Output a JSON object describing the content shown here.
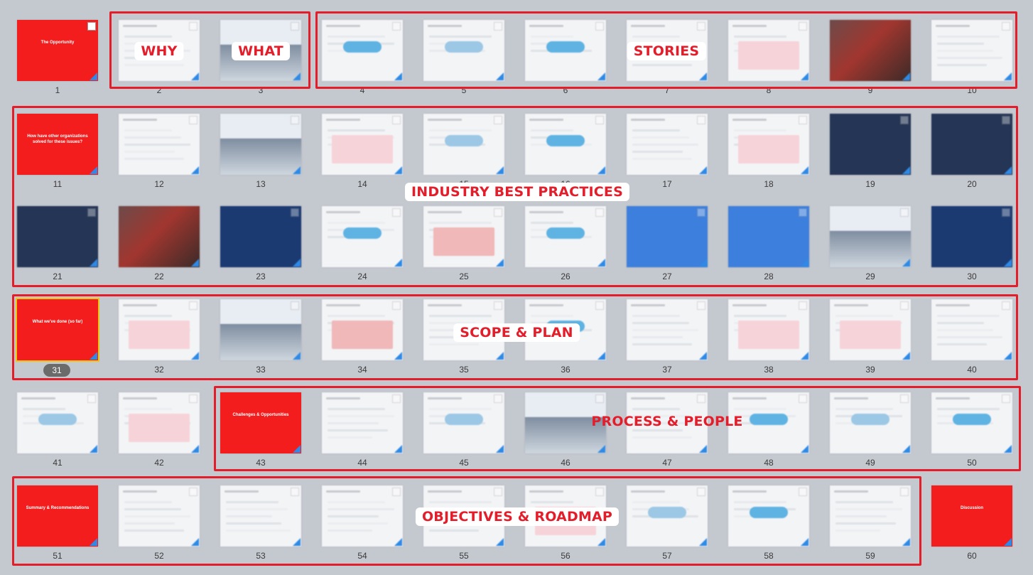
{
  "colors": {
    "accent_red": "#e41d2b",
    "slide_red": "#f31d1d",
    "selection": "#f1c40f"
  },
  "slides": [
    {
      "n": "1",
      "style": "red",
      "title": "The Opportunity"
    },
    {
      "n": "2",
      "style": "text"
    },
    {
      "n": "3",
      "style": "mixed"
    },
    {
      "n": "4",
      "style": "diagram"
    },
    {
      "n": "5",
      "style": "diagram"
    },
    {
      "n": "6",
      "style": "diagram"
    },
    {
      "n": "7",
      "style": "text"
    },
    {
      "n": "8",
      "style": "table"
    },
    {
      "n": "9",
      "style": "photo"
    },
    {
      "n": "10",
      "style": "text"
    },
    {
      "n": "11",
      "style": "red",
      "title": "How have other organizations solved for these issues?"
    },
    {
      "n": "12",
      "style": "text"
    },
    {
      "n": "13",
      "style": "mixed"
    },
    {
      "n": "14",
      "style": "table"
    },
    {
      "n": "15",
      "style": "diagram"
    },
    {
      "n": "16",
      "style": "diagram"
    },
    {
      "n": "17",
      "style": "text"
    },
    {
      "n": "18",
      "style": "table"
    },
    {
      "n": "19",
      "style": "dark"
    },
    {
      "n": "20",
      "style": "dark"
    },
    {
      "n": "21",
      "style": "dark"
    },
    {
      "n": "22",
      "style": "photo"
    },
    {
      "n": "23",
      "style": "navy"
    },
    {
      "n": "24",
      "style": "diagram"
    },
    {
      "n": "25",
      "style": "table"
    },
    {
      "n": "26",
      "style": "diagram"
    },
    {
      "n": "27",
      "style": "blue"
    },
    {
      "n": "28",
      "style": "blue"
    },
    {
      "n": "29",
      "style": "mixed"
    },
    {
      "n": "30",
      "style": "navy"
    },
    {
      "n": "31",
      "style": "red",
      "title": "What we've done (so far)",
      "selected": true
    },
    {
      "n": "32",
      "style": "table"
    },
    {
      "n": "33",
      "style": "mixed"
    },
    {
      "n": "34",
      "style": "table"
    },
    {
      "n": "35",
      "style": "text"
    },
    {
      "n": "36",
      "style": "diagram"
    },
    {
      "n": "37",
      "style": "text"
    },
    {
      "n": "38",
      "style": "table"
    },
    {
      "n": "39",
      "style": "table"
    },
    {
      "n": "40",
      "style": "text"
    },
    {
      "n": "41",
      "style": "diagram"
    },
    {
      "n": "42",
      "style": "table"
    },
    {
      "n": "43",
      "style": "red",
      "title": "Challenges & Opportunities"
    },
    {
      "n": "44",
      "style": "text"
    },
    {
      "n": "45",
      "style": "diagram"
    },
    {
      "n": "46",
      "style": "mixed"
    },
    {
      "n": "47",
      "style": "text"
    },
    {
      "n": "48",
      "style": "diagram"
    },
    {
      "n": "49",
      "style": "diagram"
    },
    {
      "n": "50",
      "style": "diagram"
    },
    {
      "n": "51",
      "style": "red",
      "title": "Summary & Recommendations"
    },
    {
      "n": "52",
      "style": "text"
    },
    {
      "n": "53",
      "style": "text"
    },
    {
      "n": "54",
      "style": "text"
    },
    {
      "n": "55",
      "style": "text"
    },
    {
      "n": "56",
      "style": "table"
    },
    {
      "n": "57",
      "style": "diagram"
    },
    {
      "n": "58",
      "style": "diagram"
    },
    {
      "n": "59",
      "style": "text"
    },
    {
      "n": "60",
      "style": "red",
      "title": "Discussion"
    }
  ],
  "labels": {
    "why": "WHY",
    "what": "WHAT",
    "stories": "STORIES",
    "industry": "INDUSTRY BEST PRACTICES",
    "scope": "SCOPE & PLAN",
    "process": "PROCESS & PEOPLE",
    "objectives": "OBJECTIVES & ROADMAP"
  }
}
